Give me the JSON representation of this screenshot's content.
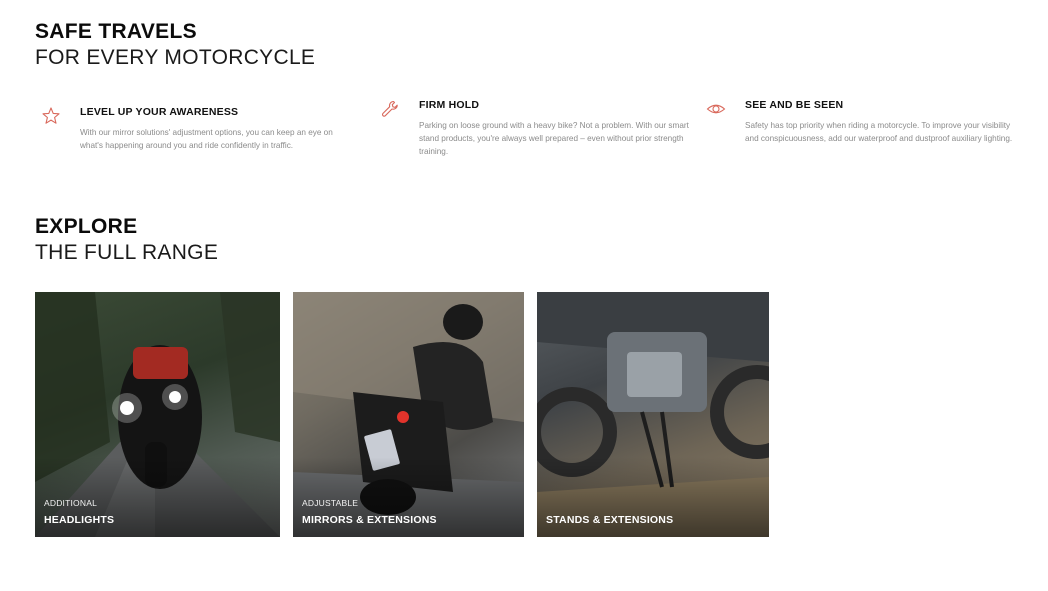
{
  "section_safe": {
    "title_strong": "SAFE TRAVELS",
    "title_light": "FOR EVERY MOTORCYCLE"
  },
  "features": [
    {
      "icon": "star-icon",
      "title": "LEVEL UP YOUR AWARENESS",
      "text": "With our mirror solutions' adjustment options, you can keep an eye on what's happening around you and ride confidently in traffic."
    },
    {
      "icon": "wrench-icon",
      "title": "FIRM HOLD",
      "text": "Parking on loose ground with a heavy bike? Not a problem. With our smart stand products, you're always well prepared – even without prior strength training."
    },
    {
      "icon": "eye-icon",
      "title": "SEE AND BE SEEN",
      "text": "Safety has top priority when riding a motorcycle. To improve your visibility and conspicuousness, add our waterproof and dustproof auxiliary lighting."
    }
  ],
  "section_explore": {
    "title_strong": "EXPLORE",
    "title_light": "THE FULL RANGE"
  },
  "cards": [
    {
      "subtitle": "ADDITIONAL",
      "title": "HEADLIGHTS"
    },
    {
      "subtitle": "ADJUSTABLE",
      "title": "MIRRORS & EXTENSIONS"
    },
    {
      "subtitle": "",
      "title": "STANDS & EXTENSIONS"
    }
  ],
  "colors": {
    "accent_icon": "#d9695c",
    "body_text": "#8b8b8b",
    "heading": "#0b0b0b"
  }
}
